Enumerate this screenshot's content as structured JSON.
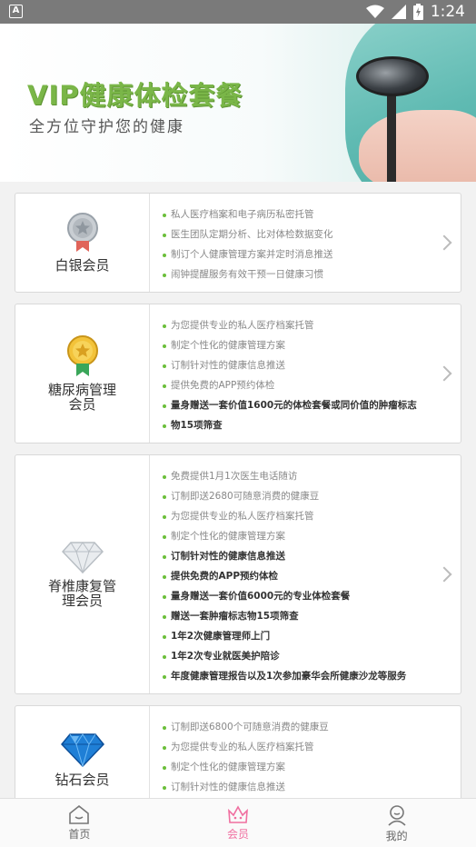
{
  "statusbar": {
    "time": "1:24",
    "app_badge": "A"
  },
  "banner": {
    "title": "VIP健康体检套餐",
    "subtitle": "全方位守护您的健康"
  },
  "cards": [
    {
      "name": "白银会员",
      "icon": "silver-medal-icon",
      "features": [
        {
          "text": "私人医疗档案和电子病历私密托管",
          "bold": false
        },
        {
          "text": "医生团队定期分析、比对体检数据变化",
          "bold": false
        },
        {
          "text": "制订个人健康管理方案并定时消息推送",
          "bold": false
        },
        {
          "text": "闹钟提醒服务有效干预一日健康习惯",
          "bold": false
        }
      ]
    },
    {
      "name": "糖尿病管理会员",
      "icon": "gold-medal-icon",
      "features": [
        {
          "text": "为您提供专业的私人医疗档案托管",
          "bold": false
        },
        {
          "text": "制定个性化的健康管理方案",
          "bold": false
        },
        {
          "text": "订制针对性的健康信息推送",
          "bold": false
        },
        {
          "text": "提供免费的APP预约体检",
          "bold": false
        },
        {
          "text": "量身赠送一套价值1600元的体检套餐或同价值的肿瘤标志",
          "bold": true
        },
        {
          "text": "物15项筛查",
          "bold": true
        }
      ]
    },
    {
      "name": "脊椎康复管理会员",
      "icon": "diamond-icon",
      "features": [
        {
          "text": "免费提供1月1次医生电话随访",
          "bold": false
        },
        {
          "text": "订制即送2680可随意消费的健康豆",
          "bold": false
        },
        {
          "text": "为您提供专业的私人医疗档案托管",
          "bold": false
        },
        {
          "text": "制定个性化的健康管理方案",
          "bold": false
        },
        {
          "text": "订制针对性的健康信息推送",
          "bold": true
        },
        {
          "text": "提供免费的APP预约体检",
          "bold": true
        },
        {
          "text": "量身赠送一套价值6000元的专业体检套餐",
          "bold": true
        },
        {
          "text": "赠送一套肿瘤标志物15项筛查",
          "bold": true
        },
        {
          "text": "1年2次健康管理师上门",
          "bold": true
        },
        {
          "text": "1年2次专业就医美护陪诊",
          "bold": true
        },
        {
          "text": "年度健康管理报告以及1次参加豪华会所健康沙龙等服务",
          "bold": true
        }
      ]
    },
    {
      "name": "钻石会员",
      "icon": "blue-gem-icon",
      "features": [
        {
          "text": "订制即送6800个可随意消费的健康豆",
          "bold": false
        },
        {
          "text": "为您提供专业的私人医疗档案托管",
          "bold": false
        },
        {
          "text": "制定个性化的健康管理方案",
          "bold": false
        },
        {
          "text": "订制针对性的健康信息推送",
          "bold": false
        }
      ]
    }
  ],
  "tabbar": {
    "items": [
      {
        "label": "首页",
        "icon": "home-icon",
        "active": false
      },
      {
        "label": "会员",
        "icon": "crown-icon",
        "active": true,
        "color": "#f06fa0"
      },
      {
        "label": "我的",
        "icon": "user-icon",
        "active": false
      }
    ]
  }
}
